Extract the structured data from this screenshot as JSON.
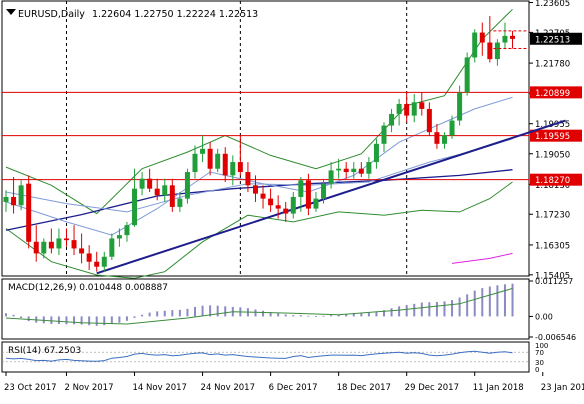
{
  "header": {
    "symbol": "EURUSD,Daily",
    "ohlc": "1.22604 1.22750 1.22224 1.22513"
  },
  "colors": {
    "background": "#ffffff",
    "grid": "#000000",
    "bull": "#1f9e3a",
    "bear": "#e00000",
    "level": "#e00000",
    "trendline": "#1d1d8c",
    "ma_navy": "#1d1d8c",
    "ma_light": "#7f9bd6",
    "bollinger": "#2f8c2f",
    "ma_magenta": "#e020e0",
    "macd_hist": "#8a8ac4",
    "macd_signal": "#3c8c3c",
    "rsi": "#3d6fc2",
    "price_label_bg": "#e00000",
    "current_label_bg": "#000000"
  },
  "chart_data": [
    {
      "type": "candlestick",
      "title": "EURUSD,Daily",
      "ylim": [
        1.1537,
        1.2365
      ],
      "y_ticks": [
        "1.23605",
        "1.22705",
        "1.21780",
        "1.20875",
        "1.19955",
        "1.19050",
        "1.18130",
        "1.17230",
        "1.16305",
        "1.15405"
      ],
      "x_ticks": [
        "23 Oct 2017",
        "2 Nov 2017",
        "14 Nov 2017",
        "24 Nov 2017",
        "6 Dec 2017",
        "18 Dec 2017",
        "29 Dec 2017",
        "11 Jan 2018",
        "23 Jan 2018"
      ],
      "x_tick_index": [
        0,
        8,
        17,
        26,
        35,
        44,
        53,
        62,
        71
      ],
      "period_separators_index": [
        8,
        31,
        53
      ],
      "current_price": "1.22513",
      "horizontal_levels": [
        "1.20899",
        "1.19595",
        "1.18270"
      ],
      "trendline": [
        {
          "i": 12,
          "p": 1.1545
        },
        {
          "i": 74,
          "p": 1.2005
        }
      ],
      "candles": [
        {
          "o": 1.176,
          "h": 1.1795,
          "l": 1.173,
          "c": 1.1775
        },
        {
          "o": 1.1775,
          "h": 1.1835,
          "l": 1.1725,
          "c": 1.175
        },
        {
          "o": 1.175,
          "h": 1.1825,
          "l": 1.1735,
          "c": 1.181
        },
        {
          "o": 1.1815,
          "h": 1.184,
          "l": 1.162,
          "c": 1.164
        },
        {
          "o": 1.164,
          "h": 1.169,
          "l": 1.158,
          "c": 1.1605
        },
        {
          "o": 1.1605,
          "h": 1.165,
          "l": 1.159,
          "c": 1.164
        },
        {
          "o": 1.164,
          "h": 1.168,
          "l": 1.1605,
          "c": 1.162
        },
        {
          "o": 1.162,
          "h": 1.168,
          "l": 1.16,
          "c": 1.165
        },
        {
          "o": 1.165,
          "h": 1.168,
          "l": 1.1625,
          "c": 1.1645
        },
        {
          "o": 1.1645,
          "h": 1.169,
          "l": 1.16,
          "c": 1.162
        },
        {
          "o": 1.162,
          "h": 1.1665,
          "l": 1.1575,
          "c": 1.1605
        },
        {
          "o": 1.1605,
          "h": 1.163,
          "l": 1.1555,
          "c": 1.158
        },
        {
          "o": 1.158,
          "h": 1.161,
          "l": 1.155,
          "c": 1.1565
        },
        {
          "o": 1.1565,
          "h": 1.161,
          "l": 1.155,
          "c": 1.1595
        },
        {
          "o": 1.1595,
          "h": 1.1665,
          "l": 1.1585,
          "c": 1.165
        },
        {
          "o": 1.165,
          "h": 1.168,
          "l": 1.1625,
          "c": 1.166
        },
        {
          "o": 1.166,
          "h": 1.17,
          "l": 1.164,
          "c": 1.169
        },
        {
          "o": 1.169,
          "h": 1.186,
          "l": 1.1685,
          "c": 1.18
        },
        {
          "o": 1.18,
          "h": 1.185,
          "l": 1.178,
          "c": 1.183
        },
        {
          "o": 1.183,
          "h": 1.186,
          "l": 1.179,
          "c": 1.18
        },
        {
          "o": 1.18,
          "h": 1.183,
          "l": 1.1765,
          "c": 1.178
        },
        {
          "o": 1.178,
          "h": 1.183,
          "l": 1.176,
          "c": 1.181
        },
        {
          "o": 1.181,
          "h": 1.183,
          "l": 1.173,
          "c": 1.1745
        },
        {
          "o": 1.1745,
          "h": 1.179,
          "l": 1.173,
          "c": 1.177
        },
        {
          "o": 1.177,
          "h": 1.186,
          "l": 1.1755,
          "c": 1.185
        },
        {
          "o": 1.185,
          "h": 1.193,
          "l": 1.183,
          "c": 1.1905
        },
        {
          "o": 1.1905,
          "h": 1.196,
          "l": 1.188,
          "c": 1.192
        },
        {
          "o": 1.192,
          "h": 1.194,
          "l": 1.184,
          "c": 1.186
        },
        {
          "o": 1.186,
          "h": 1.192,
          "l": 1.185,
          "c": 1.1905
        },
        {
          "o": 1.1905,
          "h": 1.1925,
          "l": 1.182,
          "c": 1.184
        },
        {
          "o": 1.184,
          "h": 1.19,
          "l": 1.181,
          "c": 1.188
        },
        {
          "o": 1.188,
          "h": 1.196,
          "l": 1.184,
          "c": 1.185
        },
        {
          "o": 1.185,
          "h": 1.188,
          "l": 1.179,
          "c": 1.181
        },
        {
          "o": 1.181,
          "h": 1.184,
          "l": 1.176,
          "c": 1.1785
        },
        {
          "o": 1.1785,
          "h": 1.181,
          "l": 1.174,
          "c": 1.177
        },
        {
          "o": 1.177,
          "h": 1.18,
          "l": 1.173,
          "c": 1.175
        },
        {
          "o": 1.175,
          "h": 1.178,
          "l": 1.171,
          "c": 1.174
        },
        {
          "o": 1.174,
          "h": 1.176,
          "l": 1.17,
          "c": 1.1725
        },
        {
          "o": 1.1725,
          "h": 1.179,
          "l": 1.171,
          "c": 1.1775
        },
        {
          "o": 1.1775,
          "h": 1.1835,
          "l": 1.173,
          "c": 1.1825
        },
        {
          "o": 1.1825,
          "h": 1.1845,
          "l": 1.172,
          "c": 1.174
        },
        {
          "o": 1.174,
          "h": 1.179,
          "l": 1.173,
          "c": 1.177
        },
        {
          "o": 1.177,
          "h": 1.183,
          "l": 1.1755,
          "c": 1.1815
        },
        {
          "o": 1.1815,
          "h": 1.188,
          "l": 1.18,
          "c": 1.1855
        },
        {
          "o": 1.1855,
          "h": 1.189,
          "l": 1.183,
          "c": 1.186
        },
        {
          "o": 1.186,
          "h": 1.188,
          "l": 1.183,
          "c": 1.185
        },
        {
          "o": 1.185,
          "h": 1.188,
          "l": 1.183,
          "c": 1.186
        },
        {
          "o": 1.186,
          "h": 1.188,
          "l": 1.1835,
          "c": 1.1845
        },
        {
          "o": 1.1845,
          "h": 1.1895,
          "l": 1.183,
          "c": 1.188
        },
        {
          "o": 1.188,
          "h": 1.195,
          "l": 1.186,
          "c": 1.1935
        },
        {
          "o": 1.1935,
          "h": 1.2,
          "l": 1.191,
          "c": 1.199
        },
        {
          "o": 1.199,
          "h": 1.204,
          "l": 1.197,
          "c": 1.2025
        },
        {
          "o": 1.2025,
          "h": 1.207,
          "l": 1.199,
          "c": 1.2055
        },
        {
          "o": 1.2055,
          "h": 1.209,
          "l": 1.2,
          "c": 1.202
        },
        {
          "o": 1.202,
          "h": 1.2085,
          "l": 1.2,
          "c": 1.206
        },
        {
          "o": 1.206,
          "h": 1.209,
          "l": 1.202,
          "c": 1.204
        },
        {
          "o": 1.204,
          "h": 1.206,
          "l": 1.196,
          "c": 1.197
        },
        {
          "o": 1.197,
          "h": 1.1995,
          "l": 1.192,
          "c": 1.1935
        },
        {
          "o": 1.1935,
          "h": 1.197,
          "l": 1.192,
          "c": 1.196
        },
        {
          "o": 1.196,
          "h": 1.202,
          "l": 1.195,
          "c": 1.2005
        },
        {
          "o": 1.2005,
          "h": 1.211,
          "l": 1.199,
          "c": 1.209
        },
        {
          "o": 1.209,
          "h": 1.221,
          "l": 1.208,
          "c": 1.2195
        },
        {
          "o": 1.2195,
          "h": 1.228,
          "l": 1.218,
          "c": 1.227
        },
        {
          "o": 1.227,
          "h": 1.23,
          "l": 1.22,
          "c": 1.224
        },
        {
          "o": 1.224,
          "h": 1.232,
          "l": 1.218,
          "c": 1.219
        },
        {
          "o": 1.219,
          "h": 1.225,
          "l": 1.217,
          "c": 1.224
        },
        {
          "o": 1.224,
          "h": 1.23,
          "l": 1.222,
          "c": 1.226
        },
        {
          "o": 1.226,
          "h": 1.2275,
          "l": 1.2222,
          "c": 1.2251
        }
      ],
      "moving_averages": [
        {
          "name": "ma_navy",
          "values": [
            [
              0,
              1.1675
            ],
            [
              10,
              1.1722
            ],
            [
              20,
              1.1778
            ],
            [
              30,
              1.18
            ],
            [
              40,
              1.1815
            ],
            [
              50,
              1.1825
            ],
            [
              60,
              1.184
            ],
            [
              67,
              1.1857
            ]
          ]
        },
        {
          "name": "ma_light_slow",
          "values": [
            [
              0,
              1.179
            ],
            [
              8,
              1.1755
            ],
            [
              16,
              1.173
            ],
            [
              24,
              1.178
            ],
            [
              32,
              1.1815
            ],
            [
              40,
              1.181
            ],
            [
              48,
              1.182
            ],
            [
              56,
              1.188
            ],
            [
              62,
              1.1915
            ],
            [
              67,
              1.195
            ]
          ]
        },
        {
          "name": "ma_light_fast",
          "values": [
            [
              0,
              1.176
            ],
            [
              8,
              1.17
            ],
            [
              14,
              1.166
            ],
            [
              20,
              1.174
            ],
            [
              27,
              1.185
            ],
            [
              34,
              1.1815
            ],
            [
              40,
              1.179
            ],
            [
              46,
              1.184
            ],
            [
              52,
              1.194
            ],
            [
              57,
              1.199
            ],
            [
              62,
              1.204
            ],
            [
              67,
              1.2075
            ]
          ]
        },
        {
          "name": "ma_magenta",
          "values": [
            [
              59,
              1.1575
            ],
            [
              64,
              1.159
            ],
            [
              67,
              1.1605
            ]
          ]
        }
      ],
      "bollinger": {
        "upper": [
          [
            0,
            1.1865
          ],
          [
            6,
            1.181
          ],
          [
            12,
            1.1725
          ],
          [
            18,
            1.186
          ],
          [
            24,
            1.191
          ],
          [
            29,
            1.196
          ],
          [
            35,
            1.19
          ],
          [
            41,
            1.186
          ],
          [
            47,
            1.1905
          ],
          [
            53,
            1.205
          ],
          [
            58,
            1.208
          ],
          [
            63,
            1.225
          ],
          [
            67,
            1.234
          ]
        ],
        "lower": [
          [
            0,
            1.168
          ],
          [
            6,
            1.158
          ],
          [
            12,
            1.154
          ],
          [
            17,
            1.153
          ],
          [
            21,
            1.155
          ],
          [
            26,
            1.164
          ],
          [
            32,
            1.172
          ],
          [
            38,
            1.17
          ],
          [
            44,
            1.173
          ],
          [
            50,
            1.172
          ],
          [
            55,
            1.1735
          ],
          [
            60,
            1.173
          ],
          [
            64,
            1.177
          ],
          [
            67,
            1.182
          ]
        ]
      }
    },
    {
      "type": "bar",
      "title": "MACD(12,26,9) 0.010448 0.008887",
      "y_ticks": [
        "0.011257",
        "0.00",
        "-0.006546"
      ],
      "ylim": [
        -0.006546,
        0.011257
      ],
      "histogram": [
        0.001,
        0.0005,
        -0.0005,
        -0.0015,
        -0.002,
        -0.0022,
        -0.0024,
        -0.0024,
        -0.0025,
        -0.0025,
        -0.0026,
        -0.0028,
        -0.003,
        -0.0028,
        -0.0024,
        -0.002,
        -0.0014,
        -0.0005,
        0.0005,
        0.0012,
        0.0016,
        0.0018,
        0.002,
        0.0021,
        0.0024,
        0.003,
        0.0034,
        0.0035,
        0.0034,
        0.0032,
        0.003,
        0.0029,
        0.0026,
        0.0022,
        0.0018,
        0.0014,
        0.001,
        0.0006,
        0.0004,
        0.0004,
        0.0002,
        0.0001,
        0.0002,
        0.0004,
        0.0006,
        0.0007,
        0.0008,
        0.001,
        0.0012,
        0.0016,
        0.002,
        0.0026,
        0.0032,
        0.0036,
        0.004,
        0.0044,
        0.0045,
        0.0046,
        0.0048,
        0.0052,
        0.006,
        0.007,
        0.0082,
        0.009,
        0.0095,
        0.0099,
        0.0102,
        0.0104
      ],
      "signal": [
        [
          0,
          -0.0005
        ],
        [
          10,
          -0.002
        ],
        [
          16,
          -0.0024
        ],
        [
          24,
          -0.0005
        ],
        [
          30,
          0.0015
        ],
        [
          38,
          0.001
        ],
        [
          44,
          0.0005
        ],
        [
          52,
          0.002
        ],
        [
          60,
          0.004
        ],
        [
          67,
          0.0089
        ]
      ]
    },
    {
      "type": "line",
      "title": "RSI(14) 67.2503",
      "y_ticks": [
        "100",
        "70",
        "30",
        "0"
      ],
      "ylim": [
        0,
        100
      ],
      "values": [
        45,
        42,
        44,
        40,
        35,
        36,
        33,
        38,
        40,
        36,
        34,
        33,
        32,
        35,
        45,
        48,
        52,
        62,
        65,
        60,
        58,
        60,
        55,
        57,
        62,
        66,
        67,
        60,
        63,
        58,
        60,
        56,
        52,
        50,
        48,
        46,
        45,
        44,
        52,
        56,
        48,
        52,
        55,
        58,
        58,
        57,
        58,
        56,
        60,
        63,
        66,
        68,
        70,
        66,
        68,
        65,
        58,
        55,
        58,
        62,
        68,
        72,
        74,
        70,
        66,
        70,
        72,
        67
      ]
    }
  ]
}
